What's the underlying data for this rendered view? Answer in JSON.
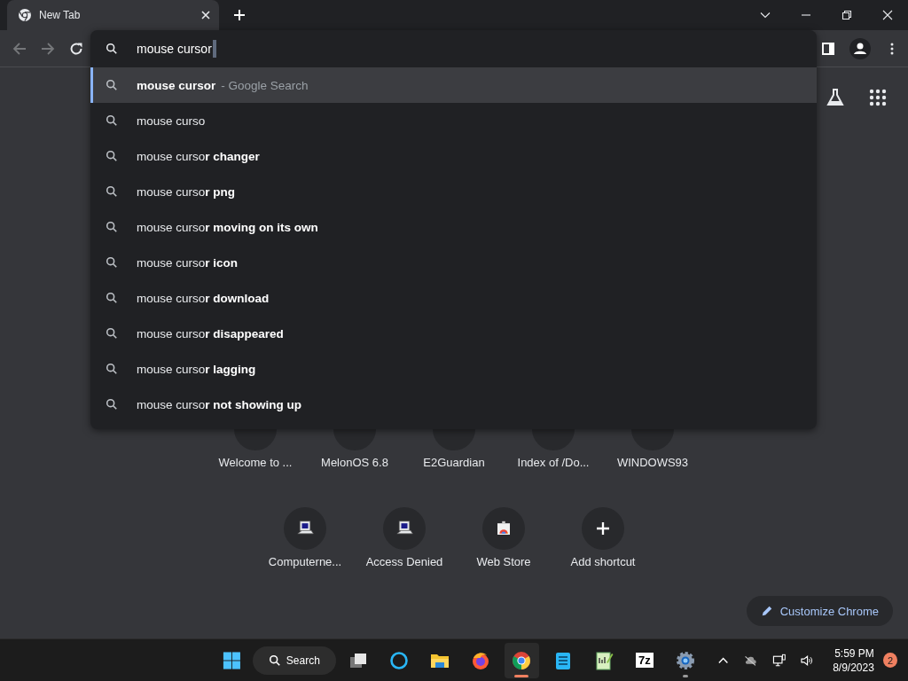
{
  "tab": {
    "title": "New Tab",
    "selected": true
  },
  "toolbar": {
    "back_disabled": true,
    "forward_disabled": true
  },
  "omnibox": {
    "value": "mouse cursor"
  },
  "suggestions": [
    {
      "text": "**mouse cursor**",
      "description": "- Google Search",
      "selected": true
    },
    {
      "text": "mouse curso",
      "selected": false
    },
    {
      "text": "mouse curso**r changer**",
      "selected": false
    },
    {
      "text": "mouse curso**r png**",
      "selected": false
    },
    {
      "text": "mouse curso**r moving on its own**",
      "selected": false
    },
    {
      "text": "mouse curso**r icon**",
      "selected": false
    },
    {
      "text": "mouse curso**r download**",
      "selected": false
    },
    {
      "text": "mouse curso**r disappeared**",
      "selected": false
    },
    {
      "text": "mouse curso**r lagging**",
      "selected": false
    },
    {
      "text": "mouse curso**r not showing up**",
      "selected": false
    }
  ],
  "shortcut_rows": [
    [
      {
        "label": "Welcome to ...",
        "kind": "hidden"
      },
      {
        "label": "MelonOS 6.8",
        "kind": "hidden"
      },
      {
        "label": "E2Guardian",
        "kind": "hidden"
      },
      {
        "label": "Index of /Do...",
        "kind": "hidden"
      },
      {
        "label": "WINDOWS93",
        "kind": "hidden"
      }
    ],
    [
      {
        "label": "Computerne...",
        "kind": "computer"
      },
      {
        "label": "Access Denied",
        "kind": "computer"
      },
      {
        "label": "Web Store",
        "kind": "store"
      },
      {
        "label": "Add shortcut",
        "kind": "add"
      }
    ]
  ],
  "customize_button": "Customize Chrome",
  "taskbar": {
    "search": "Search",
    "apps": [
      {
        "kind": "taskview",
        "active": false,
        "running": false
      },
      {
        "kind": "cortana",
        "active": false,
        "running": false
      },
      {
        "kind": "explorer",
        "active": false,
        "running": false
      },
      {
        "kind": "firefox",
        "active": false,
        "running": false
      },
      {
        "kind": "chrome",
        "active": true,
        "running": true
      },
      {
        "kind": "notepad",
        "active": false,
        "running": false
      },
      {
        "kind": "editor",
        "active": false,
        "running": false
      },
      {
        "kind": "sevenzip",
        "label": "7z",
        "active": false,
        "running": false
      },
      {
        "kind": "settings",
        "active": false,
        "running": true
      }
    ],
    "time": "5:59 PM",
    "date": "8/9/2023",
    "notifications": "2"
  }
}
